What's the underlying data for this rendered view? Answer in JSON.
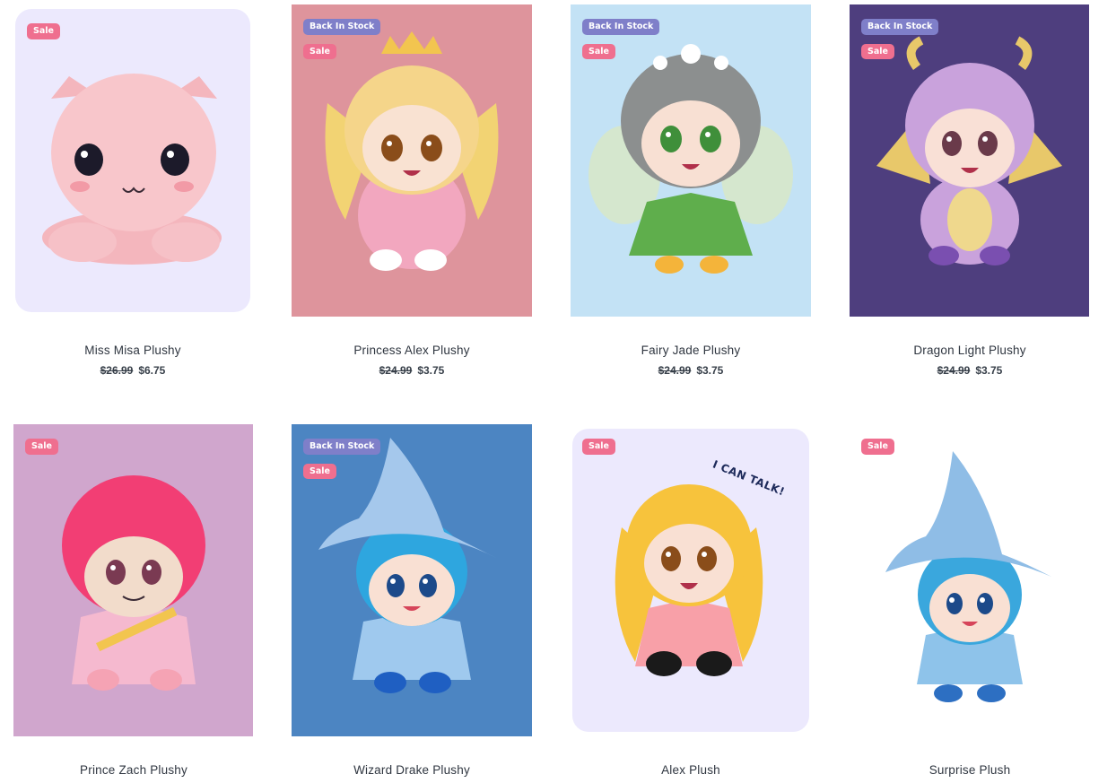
{
  "products": [
    {
      "name": "Miss Misa Plushy",
      "old_price": "$26.99",
      "price": "$6.75",
      "badges": {
        "stock": "",
        "sale": "Sale"
      },
      "bg": "#ece9fd"
    },
    {
      "name": "Princess Alex Plushy",
      "old_price": "$24.99",
      "price": "$3.75",
      "badges": {
        "stock": "Back In Stock",
        "sale": "Sale"
      },
      "bg": "#de949c"
    },
    {
      "name": "Fairy Jade Plushy",
      "old_price": "$24.99",
      "price": "$3.75",
      "badges": {
        "stock": "Back In Stock",
        "sale": "Sale"
      },
      "bg": "#c3e2f5"
    },
    {
      "name": "Dragon Light Plushy",
      "old_price": "$24.99",
      "price": "$3.75",
      "badges": {
        "stock": "Back In Stock",
        "sale": "Sale"
      },
      "bg": "#4e3e7e"
    },
    {
      "name": "Prince Zach Plushy",
      "badges": {
        "stock": "",
        "sale": "Sale"
      },
      "bg": "#d0a6cd"
    },
    {
      "name": "Wizard Drake Plushy",
      "badges": {
        "stock": "Back In Stock",
        "sale": "Sale"
      },
      "bg": "#4c85c2"
    },
    {
      "name": "Alex Plush",
      "badges": {
        "stock": "",
        "sale": "Sale"
      },
      "bg": "#ece9fd",
      "speech": "I CAN TALK!"
    },
    {
      "name": "Surprise Plush",
      "badges": {
        "stock": "",
        "sale": "Sale"
      },
      "bg": "#ffffff"
    }
  ]
}
